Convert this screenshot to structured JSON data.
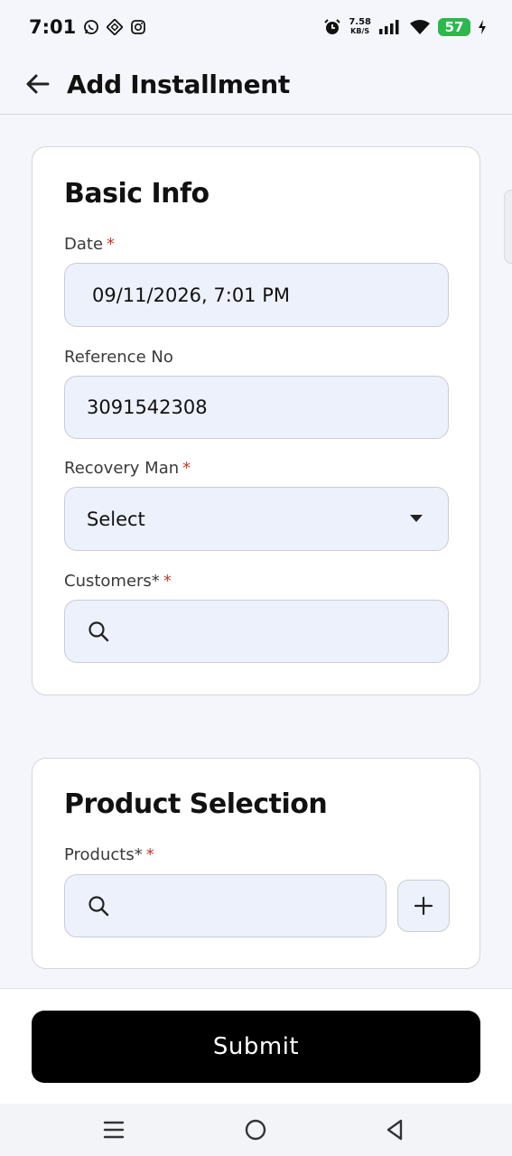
{
  "status_bar": {
    "time": "7:01",
    "net_speed_value": "7.58",
    "net_speed_unit": "KB/S",
    "battery": "57"
  },
  "app_bar": {
    "title": "Add Installment"
  },
  "basic_info": {
    "title": "Basic Info",
    "date": {
      "label": "Date",
      "required": "*",
      "value": "09/11/2026, 7:01 PM"
    },
    "reference": {
      "label": "Reference No",
      "value": "3091542308"
    },
    "recovery_man": {
      "label": "Recovery Man",
      "required": "*",
      "value": "Select"
    },
    "customers": {
      "label": "Customers*",
      "required": "*",
      "value": ""
    }
  },
  "product_selection": {
    "title": "Product Selection",
    "products": {
      "label": "Products*",
      "required": "*",
      "value": ""
    }
  },
  "footer": {
    "submit_label": "Submit"
  },
  "colors": {
    "accent": "#000000",
    "field_bg": "#edf1fb",
    "required": "#c0392b",
    "battery": "#2db84d"
  },
  "icons": [
    "back-arrow-icon",
    "search-icon",
    "plus-icon",
    "chevron-down-icon",
    "whatsapp-icon",
    "instagram-icon",
    "alarm-icon",
    "wifi-icon",
    "signal-icon",
    "charging-icon",
    "menu-icon",
    "home-icon",
    "back-icon"
  ]
}
